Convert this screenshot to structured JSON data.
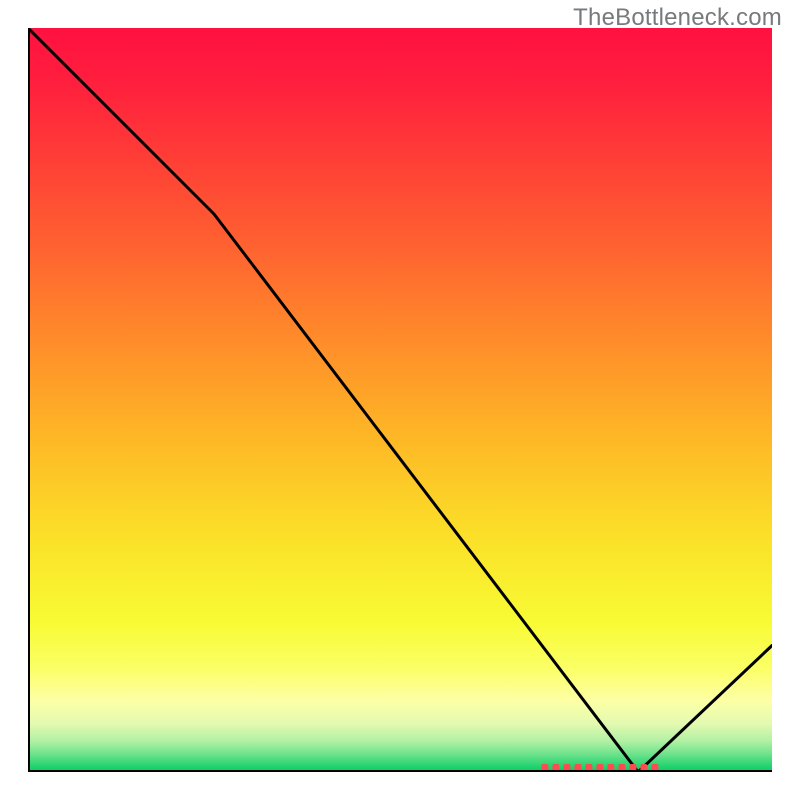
{
  "watermark": "TheBottleneck.com",
  "chart_data": {
    "type": "line",
    "title": "",
    "xlabel": "",
    "ylabel": "",
    "xlim": [
      0,
      100
    ],
    "ylim": [
      0,
      100
    ],
    "grid": false,
    "legend": false,
    "x": [
      0,
      25,
      82,
      100
    ],
    "values": [
      100,
      75,
      0,
      17
    ],
    "background_gradient": {
      "type": "vertical",
      "stops": [
        {
          "offset": 0.0,
          "color": "#ff1140"
        },
        {
          "offset": 0.07,
          "color": "#ff1e3e"
        },
        {
          "offset": 0.18,
          "color": "#ff3f36"
        },
        {
          "offset": 0.3,
          "color": "#ff6430"
        },
        {
          "offset": 0.42,
          "color": "#ff8c2a"
        },
        {
          "offset": 0.55,
          "color": "#feb726"
        },
        {
          "offset": 0.68,
          "color": "#fbdf28"
        },
        {
          "offset": 0.8,
          "color": "#f8fb34"
        },
        {
          "offset": 0.86,
          "color": "#fbff65"
        },
        {
          "offset": 0.905,
          "color": "#fdffa6"
        },
        {
          "offset": 0.935,
          "color": "#e3fab0"
        },
        {
          "offset": 0.958,
          "color": "#b2f1a4"
        },
        {
          "offset": 0.975,
          "color": "#72e38d"
        },
        {
          "offset": 0.99,
          "color": "#2dd574"
        },
        {
          "offset": 1.0,
          "color": "#0acc63"
        }
      ]
    },
    "marker": {
      "x_start": 69,
      "x_end": 85,
      "y": 0,
      "color": "#ff4a4f",
      "style": "dashed-band"
    },
    "axis_color": "#000000",
    "line_color": "#000000"
  }
}
